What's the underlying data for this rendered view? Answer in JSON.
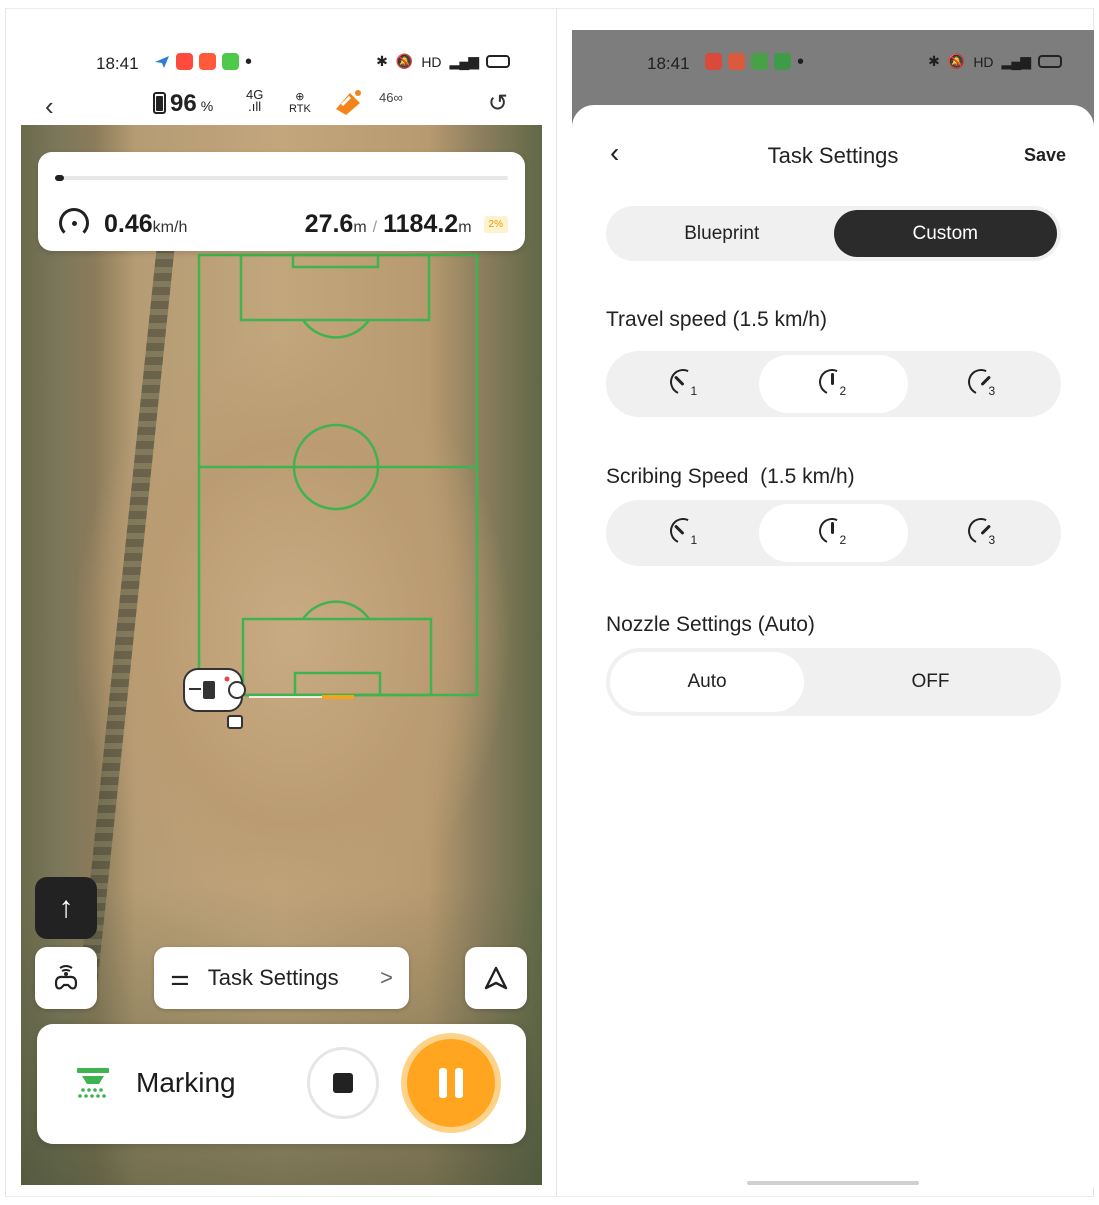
{
  "status_bar": {
    "time": "18:41",
    "right_icons": [
      "bluetooth-icon",
      "mute-icon",
      "hd-label",
      "4g-signal-icon",
      "battery-icon"
    ],
    "hd": "HD",
    "network": "4G"
  },
  "toolbar": {
    "battery_value": "96",
    "battery_unit": "%",
    "signal_label": "4G",
    "rtk_label": "RTK",
    "link_label": "46"
  },
  "progress": {
    "fraction": 0.02,
    "speed_value": "0.46",
    "speed_unit": "km/h",
    "traveled_value": "27.6",
    "traveled_unit": "m",
    "separator": "/",
    "total_value": "1184.2",
    "total_unit": "m",
    "percent": "2%"
  },
  "map_controls": {
    "task_settings_label": "Task Settings",
    "chevron": ">"
  },
  "bottom": {
    "mode_label": "Marking"
  },
  "task_settings": {
    "title": "Task Settings",
    "save_label": "Save",
    "mode_tabs": [
      {
        "label": "Blueprint",
        "selected": false
      },
      {
        "label": "Custom",
        "selected": true
      }
    ],
    "travel_speed_title": "Travel speed (1.5 km/h)",
    "scribing_speed_title": "Scribing Speed  (1.5 km/h)",
    "speed_levels": [
      "1",
      "2",
      "3"
    ],
    "travel_selected": "2",
    "scribing_selected": "2",
    "nozzle_title": "Nozzle Settings (Auto)",
    "nozzle_options": [
      {
        "label": "Auto",
        "selected": true
      },
      {
        "label": "OFF",
        "selected": false
      }
    ]
  },
  "colors": {
    "accent_orange": "#ffa51f",
    "field_lines": "#3fb34f",
    "dark": "#2b2b2b"
  }
}
